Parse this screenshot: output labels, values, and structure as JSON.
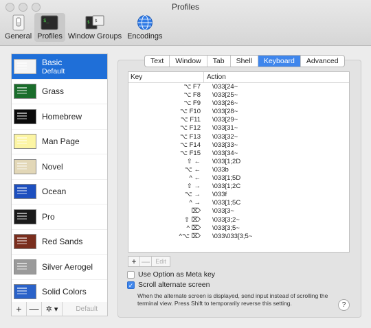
{
  "window": {
    "title": "Profiles"
  },
  "toolbar": [
    {
      "label": "General",
      "icon": "general-switch-icon"
    },
    {
      "label": "Profiles",
      "icon": "terminal-icon",
      "active": true
    },
    {
      "label": "Window Groups",
      "icon": "window-groups-icon"
    },
    {
      "label": "Encodings",
      "icon": "globe-icon"
    }
  ],
  "profiles": [
    {
      "name": "Basic",
      "sub": "Default",
      "selected": true,
      "color": "#f0f0f0"
    },
    {
      "name": "Grass",
      "color": "#1a6d2b"
    },
    {
      "name": "Homebrew",
      "color": "#0a0a0a"
    },
    {
      "name": "Man Page",
      "color": "#fcf5a4"
    },
    {
      "name": "Novel",
      "color": "#e2d7b7"
    },
    {
      "name": "Ocean",
      "color": "#1d4fbf"
    },
    {
      "name": "Pro",
      "color": "#1a1a1a"
    },
    {
      "name": "Red Sands",
      "color": "#7a2e1e"
    },
    {
      "name": "Silver Aerogel",
      "color": "#9a9a9a"
    },
    {
      "name": "Solid Colors",
      "color": "#2a62c9"
    }
  ],
  "list_buttons": {
    "add": "+",
    "remove": "—",
    "gear": "✲ ▾",
    "default": "Default"
  },
  "tabs": [
    {
      "label": "Text"
    },
    {
      "label": "Window"
    },
    {
      "label": "Tab"
    },
    {
      "label": "Shell"
    },
    {
      "label": "Keyboard",
      "active": true
    },
    {
      "label": "Advanced"
    }
  ],
  "key_table": {
    "headers": {
      "key": "Key",
      "action": "Action"
    },
    "rows": [
      {
        "key": "⌥ F7",
        "action": "\\033[24~"
      },
      {
        "key": "⌥ F8",
        "action": "\\033[25~"
      },
      {
        "key": "⌥ F9",
        "action": "\\033[26~"
      },
      {
        "key": "⌥ F10",
        "action": "\\033[28~"
      },
      {
        "key": "⌥ F11",
        "action": "\\033[29~"
      },
      {
        "key": "⌥ F12",
        "action": "\\033[31~"
      },
      {
        "key": "⌥ F13",
        "action": "\\033[32~"
      },
      {
        "key": "⌥ F14",
        "action": "\\033[33~"
      },
      {
        "key": "⌥ F15",
        "action": "\\033[34~"
      },
      {
        "key": "⇧ ←",
        "action": "\\033[1;2D"
      },
      {
        "key": "⌥ ←",
        "action": "\\033b"
      },
      {
        "key": "^ ←",
        "action": "\\033[1;5D"
      },
      {
        "key": "⇧ →",
        "action": "\\033[1;2C"
      },
      {
        "key": "⌥ →",
        "action": "\\033f"
      },
      {
        "key": "^ →",
        "action": "\\033[1;5C"
      },
      {
        "key": "⌦",
        "action": "\\033[3~"
      },
      {
        "key": "⇧ ⌦",
        "action": "\\033[3;2~"
      },
      {
        "key": "^ ⌦",
        "action": "\\033[3;5~"
      },
      {
        "key": "^⌥ ⌦",
        "action": "\\033\\033[3;5~"
      }
    ]
  },
  "table_buttons": {
    "add": "+",
    "remove": "—",
    "edit": "Edit"
  },
  "options": {
    "meta_key": {
      "label": "Use Option as Meta key",
      "checked": false
    },
    "scroll_alt": {
      "label": "Scroll alternate screen",
      "checked": true
    },
    "note": "When the alternate screen is displayed, send input instead of scrolling the terminal view. Press Shift to temporarily reverse this setting."
  },
  "help": "?"
}
